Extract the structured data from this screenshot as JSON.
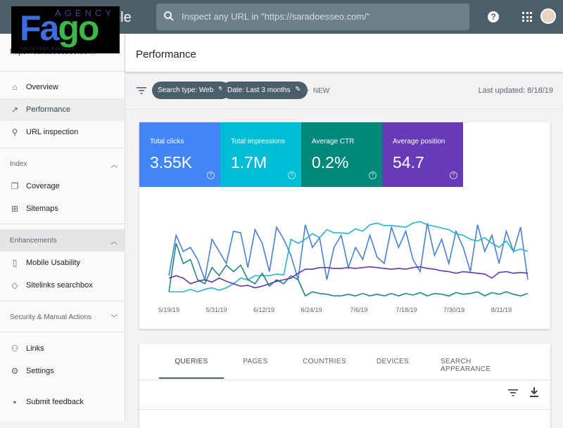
{
  "header": {
    "app_title": "ole",
    "search_placeholder": "Inspect any URL in \"https://saradoesseo.com/\"",
    "help_icon": "?"
  },
  "logo": {
    "text_top": "AGENCY",
    "text_main_1": "Fa",
    "text_main_2": "go",
    "tagline": "GROW YOUR BUSINESS"
  },
  "sidebar": {
    "property": "https://saradoesseo.com/",
    "items": [
      {
        "label": "Overview",
        "icon": "home-icon"
      },
      {
        "label": "Performance",
        "icon": "trending-up-icon",
        "active": true
      },
      {
        "label": "URL inspection",
        "icon": "search-icon"
      },
      {
        "label": "Coverage",
        "icon": "copy-icon"
      },
      {
        "label": "Sitemaps",
        "icon": "sitemap-icon"
      },
      {
        "label": "Mobile Usability",
        "icon": "phone-icon"
      },
      {
        "label": "Sitelinks searchbox",
        "icon": "layers-icon"
      },
      {
        "label": "Links",
        "icon": "links-icon"
      },
      {
        "label": "Settings",
        "icon": "gear-icon"
      },
      {
        "label": "Submit feedback",
        "icon": "feedback-icon"
      }
    ],
    "sections": [
      {
        "label": "Index",
        "expanded": true
      },
      {
        "label": "Enhancements",
        "expanded": true
      },
      {
        "label": "Security & Manual Actions",
        "expanded": false
      }
    ]
  },
  "main": {
    "title": "Performance",
    "filters": [
      {
        "label": "Search type: Web"
      },
      {
        "label": "Date: Last 3 months"
      }
    ],
    "new_label": "NEW",
    "last_updated": "Last updated: 8/18/19",
    "metrics": [
      {
        "title": "Total clicks",
        "value": "3.55K",
        "color": "#4285f4"
      },
      {
        "title": "Total impressions",
        "value": "1.7M",
        "color": "#00bcd4"
      },
      {
        "title": "Average CTR",
        "value": "0.2%",
        "color": "#00897b"
      },
      {
        "title": "Average position",
        "value": "54.7",
        "color": "#673ab7"
      }
    ],
    "tabs": [
      "QUERIES",
      "PAGES",
      "COUNTRIES",
      "DEVICES",
      "SEARCH APPEARANCE"
    ],
    "active_tab": "QUERIES"
  },
  "chart_data": {
    "type": "line",
    "x_ticks": [
      "5/19/19",
      "5/31/19",
      "6/12/19",
      "6/24/19",
      "7/6/19",
      "7/18/19",
      "7/30/19",
      "8/11/19"
    ],
    "grid": false,
    "y_scale": "relative 0-100 (no axis printed)",
    "series": [
      {
        "metric": "Total clicks",
        "color": "#4a7fd4",
        "values": [
          25,
          75,
          55,
          60,
          45,
          20,
          70,
          55,
          40,
          80,
          78,
          35,
          82,
          65,
          30,
          85,
          70,
          50,
          20,
          88,
          60,
          72,
          20,
          60,
          75,
          35,
          60,
          45,
          75,
          48,
          40,
          85,
          60,
          80,
          45,
          30,
          90,
          50,
          70,
          40,
          80,
          60,
          30,
          88,
          55,
          75,
          40,
          80,
          55,
          85,
          20
        ]
      },
      {
        "metric": "Total impressions",
        "color": "#26b5cc",
        "values": [
          5,
          5,
          5,
          8,
          5,
          8,
          10,
          7,
          10,
          15,
          22,
          20,
          25,
          25,
          25,
          27,
          26,
          70,
          65,
          70,
          77,
          72,
          82,
          78,
          78,
          77,
          83,
          80,
          88,
          90,
          87,
          87,
          86,
          85,
          90,
          92,
          88,
          86,
          84,
          82,
          77,
          75,
          70,
          68,
          72,
          65,
          60,
          68,
          55,
          58,
          55
        ]
      },
      {
        "metric": "Average CTR",
        "color": "#1f8a78",
        "values": [
          5,
          65,
          40,
          45,
          20,
          15,
          35,
          25,
          38,
          30,
          38,
          20,
          15,
          28,
          12,
          20,
          15,
          25,
          20,
          0,
          5,
          3,
          2,
          0,
          0,
          2,
          0,
          3,
          0,
          2,
          0,
          3,
          0,
          3,
          1,
          4,
          0,
          3,
          2,
          0,
          4,
          2,
          3,
          5,
          0,
          4,
          2,
          5,
          2,
          0,
          3
        ]
      },
      {
        "metric": "Average position",
        "color": "#5e35b1",
        "values": [
          22,
          25,
          22,
          15,
          18,
          20,
          17,
          22,
          18,
          15,
          12,
          13,
          10,
          12,
          15,
          18,
          20,
          22,
          28,
          33,
          33,
          35,
          35,
          34,
          34,
          35,
          34,
          35,
          36,
          35,
          34,
          33,
          34,
          33,
          35,
          36,
          34,
          33,
          31,
          30,
          28,
          30,
          29,
          28,
          27,
          22,
          29,
          30,
          28,
          29,
          28
        ]
      }
    ]
  },
  "tools": {
    "filter_icon": "filter-icon",
    "download_icon": "download-icon"
  }
}
